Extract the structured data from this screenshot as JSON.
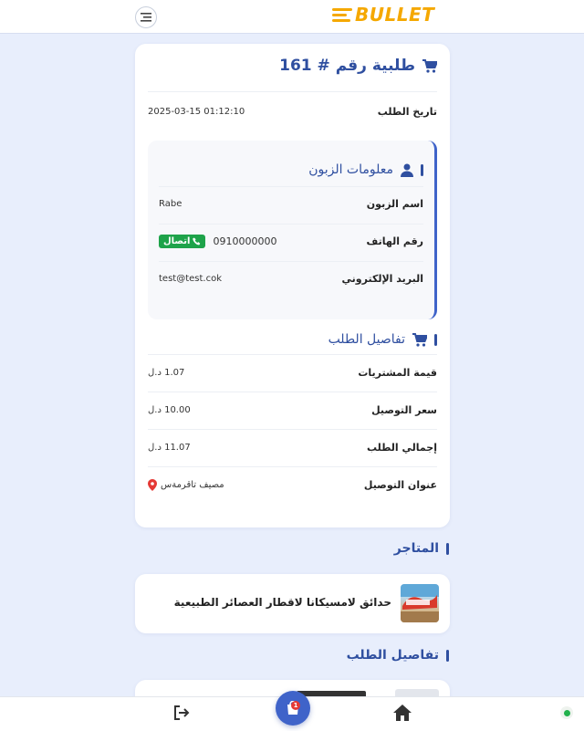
{
  "header": {
    "logo_text": "BULLET",
    "menu_icon": "menu-icon",
    "brand_color": "#f5a800"
  },
  "order": {
    "title": "طلبية رقم # 161",
    "date_label": "تاريخ الطلب",
    "date_value": "2025-03-15 01:12:10",
    "customer_section": {
      "title": "معلومات الزبون",
      "name_label": "اسم الزبون",
      "name_value": "Rabe",
      "phone_label": "رقم الهاتف",
      "phone_value": "0910000000",
      "call_label": "اتصال",
      "email_label": "البريد الإلكتروني",
      "email_value": "test@test.cok"
    },
    "details_section": {
      "title": "تفاصيل الطلب",
      "purchases_label": "قيمة المشتريات",
      "purchases_value": "1.07 د.ل",
      "delivery_label": "سعر التوصيل",
      "delivery_value": "10.00 د.ل",
      "total_label": "إجمالي الطلب",
      "total_value": "11.07 د.ل",
      "address_label": "عنوان التوصيل",
      "address_value": "مصيف تاقرمةس"
    }
  },
  "stores": {
    "title": "المتاجر",
    "items": [
      {
        "name": "حدائق لامسيكانا لاقطار العصائر الطبيعية"
      }
    ]
  },
  "order_details_title": "تفاصيل الطلب",
  "bottom_nav": {
    "cart_badge": "1",
    "accent_color": "#3f63c9",
    "status_color": "#22b14c"
  }
}
